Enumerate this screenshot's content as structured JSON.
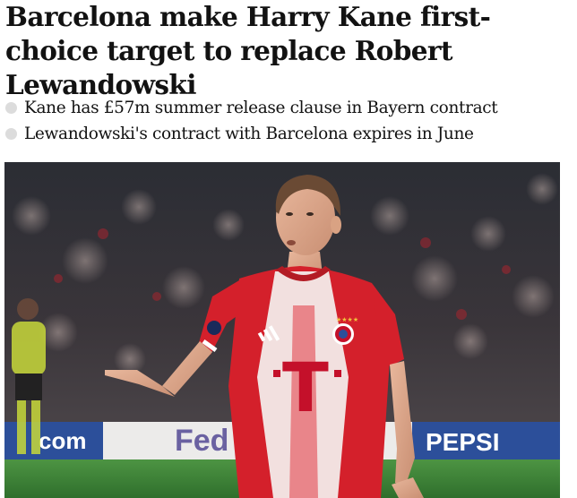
{
  "article": {
    "headline": "Barcelona make Harry Kane first-choice target to replace Robert Lewandowski",
    "standfirst": [
      "Kane has £57m summer release clause in Bayern contract",
      "Lewandowski's contract with Barcelona expires in June"
    ]
  },
  "photo": {
    "description_icon": "football-player-photo",
    "board_texts": [
      "com",
      "Fed",
      "PEPSI"
    ],
    "shirt_logo": "T",
    "shirt_brand_stripes": "adidas",
    "colors": {
      "shirt_red": "#d4202b",
      "shirt_white": "#f4f1ef",
      "crowd": "#2a2c33",
      "pitch": "#3f8a3a"
    }
  }
}
